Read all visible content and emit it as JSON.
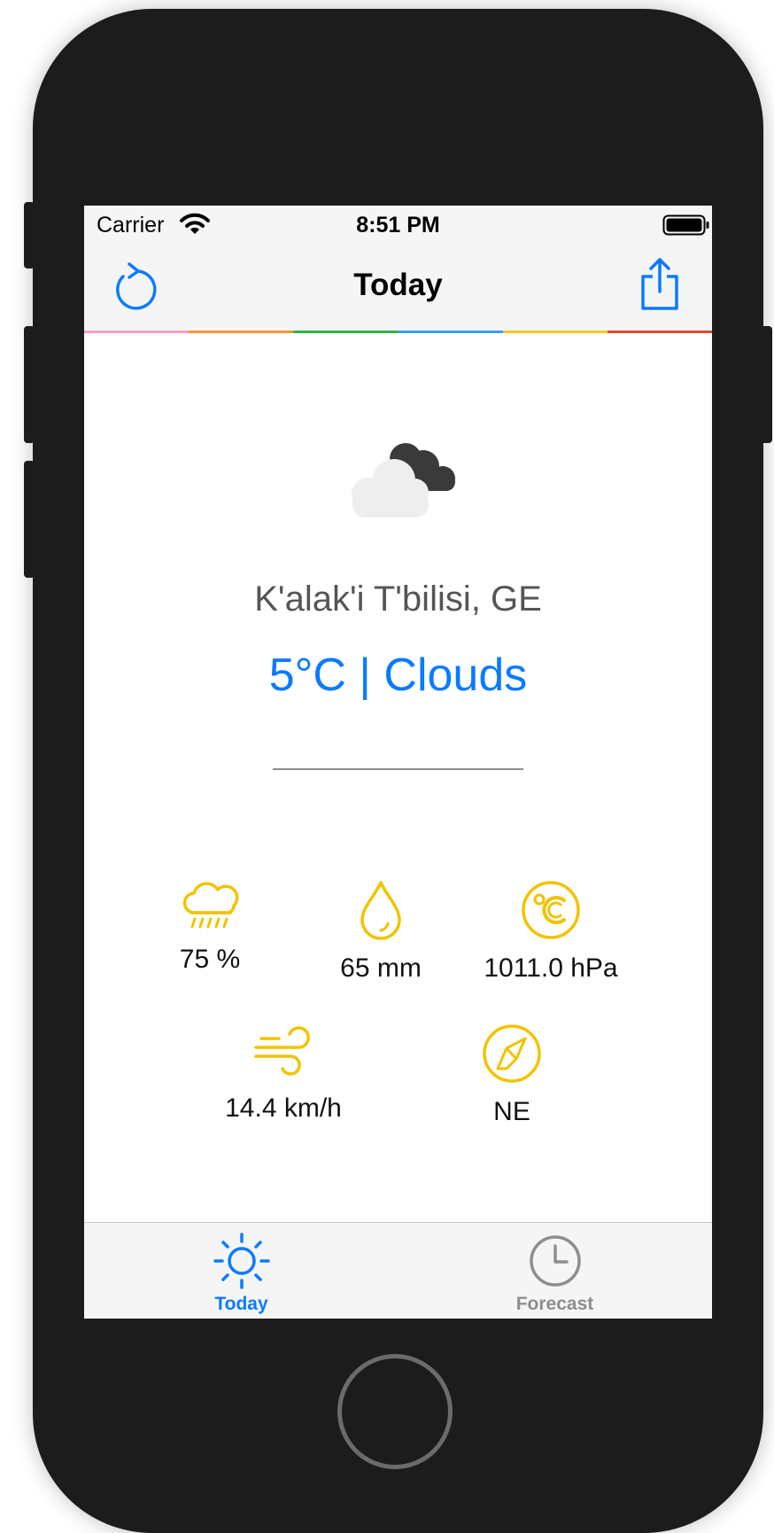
{
  "status_bar": {
    "carrier": "Carrier",
    "time": "8:51 PM"
  },
  "nav_bar": {
    "title": "Today"
  },
  "colors": {
    "accent": "#0a7bff",
    "stat_icon": "#f2c300",
    "strip": [
      "#f2a0c6",
      "#f0993a",
      "#33b14b",
      "#3a9ff0",
      "#f4c928",
      "#e04b3a"
    ]
  },
  "weather": {
    "icon": "cloudy-icon",
    "location": "K'alak'i T'bilisi, GE",
    "condition": "5°C | Clouds"
  },
  "stats": [
    {
      "icon": "rain-cloud-icon",
      "value": "75 %"
    },
    {
      "icon": "water-drop-icon",
      "value": "65 mm"
    },
    {
      "icon": "celsius-icon",
      "value": "1011.0 hPa"
    },
    {
      "icon": "wind-icon",
      "value": "14.4 km/h"
    },
    {
      "icon": "compass-icon",
      "value": "NE"
    }
  ],
  "tabs": [
    {
      "label": "Today",
      "icon": "sun-icon",
      "selected": true
    },
    {
      "label": "Forecast",
      "icon": "clock-icon",
      "selected": false
    }
  ]
}
